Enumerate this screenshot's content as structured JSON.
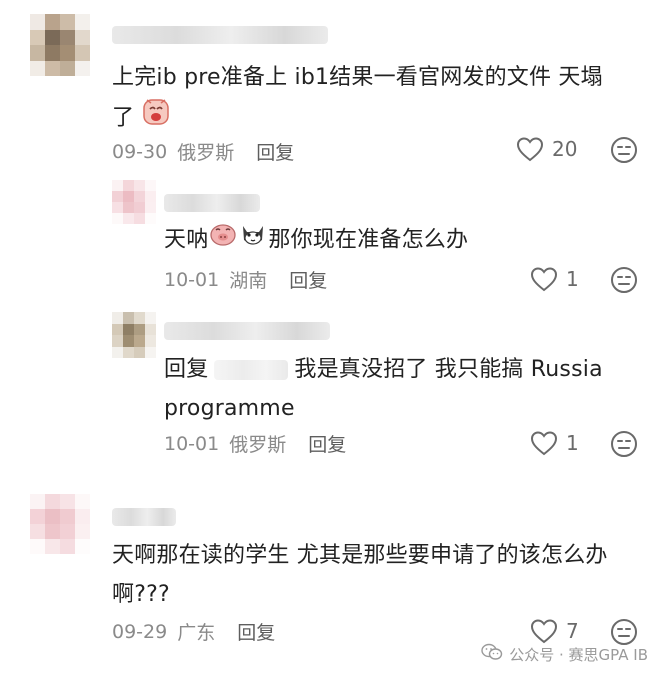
{
  "comments": [
    {
      "text": "上完ib pre准备上 ib1结果一看官网发的文件 天塌",
      "text_line2": "了",
      "date": "09-30",
      "location": "俄罗斯",
      "reply_label": "回复",
      "likes": "20"
    },
    {
      "text_prefix": "天呐",
      "text_suffix": "那你现在准备怎么办",
      "date": "10-01",
      "location": "湖南",
      "reply_label": "回复",
      "likes": "1"
    },
    {
      "reply_prefix": "回复",
      "text": "我是真没招了 我只能搞 Russia",
      "text_line2": "programme",
      "date": "10-01",
      "location": "俄罗斯",
      "reply_label": "回复",
      "likes": "1"
    },
    {
      "text": "天啊那在读的学生 尤其是那些要申请了的该怎么办",
      "text_line2": "啊???",
      "date": "09-29",
      "location": "广东",
      "reply_label": "回复",
      "likes": "7"
    }
  ],
  "watermark": {
    "text": "公众号 · 赛思GPA IB"
  },
  "icons": {
    "like": "heart-outline-icon",
    "dislike": "meh-face-icon",
    "wechat": "wechat-logo-icon"
  },
  "colors": {
    "text": "#222222",
    "meta": "#8a8a8a",
    "icon": "#6a6a6a"
  }
}
